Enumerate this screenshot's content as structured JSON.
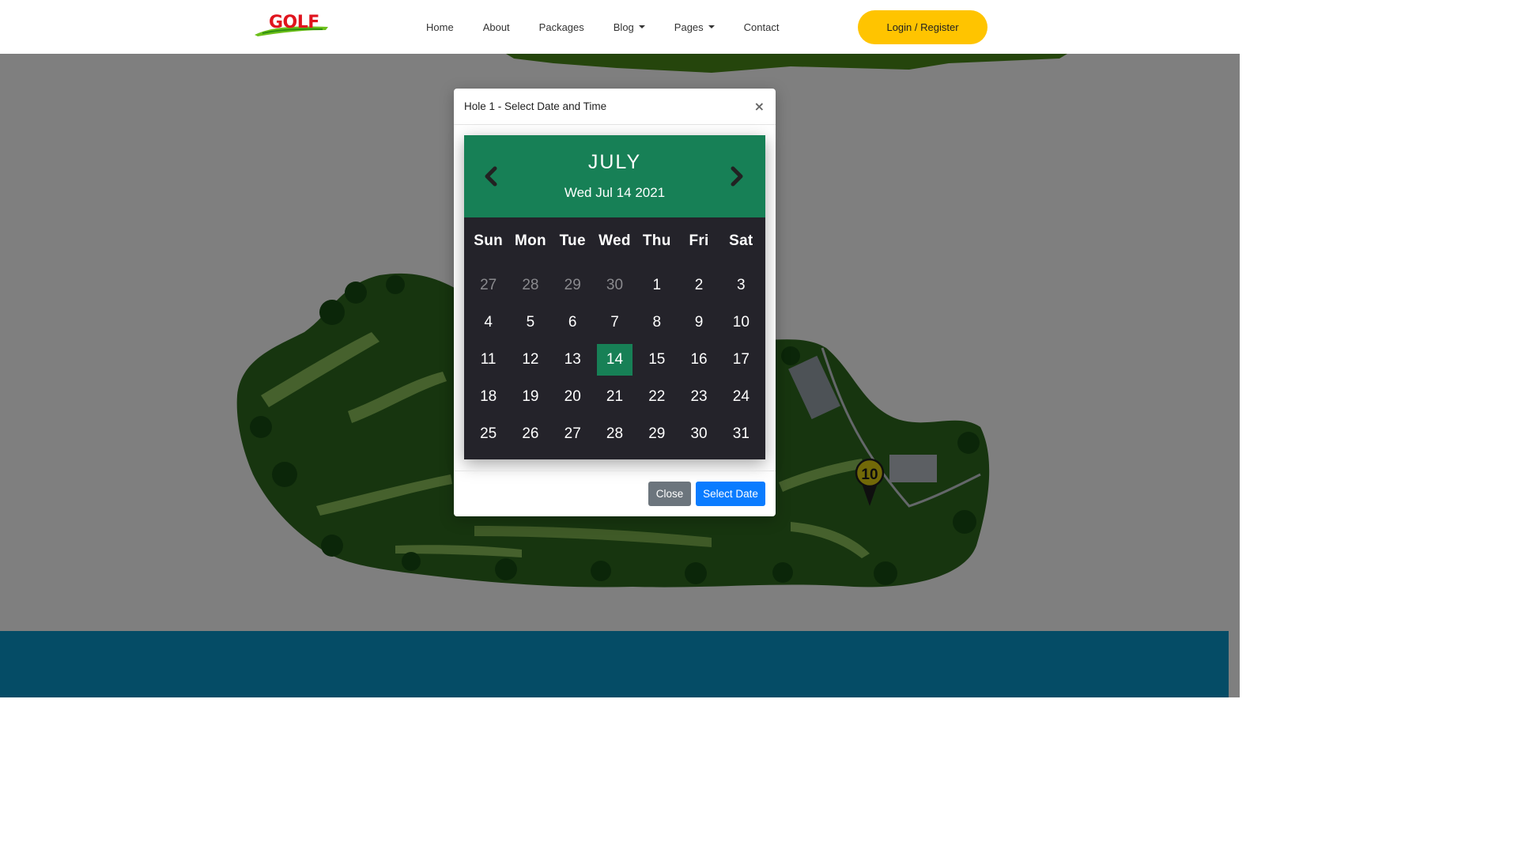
{
  "nav": {
    "logo_text": "GOLF",
    "links": [
      {
        "label": "Home"
      },
      {
        "label": "About"
      },
      {
        "label": "Packages"
      },
      {
        "label": "Blog"
      },
      {
        "label": "Pages"
      },
      {
        "label": "Contact"
      }
    ],
    "login_label": "Login / Register"
  },
  "map": {
    "marker_label": "10"
  },
  "modal": {
    "title": "Hole 1 - Select Date and Time",
    "close_symbol": "×",
    "calendar": {
      "month": "JULY",
      "selected_date_text": "Wed Jul 14 2021",
      "weekdays": [
        "Sun",
        "Mon",
        "Tue",
        "Wed",
        "Thu",
        "Fri",
        "Sat"
      ],
      "days": [
        {
          "label": "27",
          "muted": true
        },
        {
          "label": "28",
          "muted": true
        },
        {
          "label": "29",
          "muted": true
        },
        {
          "label": "30",
          "muted": true
        },
        {
          "label": "1"
        },
        {
          "label": "2"
        },
        {
          "label": "3"
        },
        {
          "label": "4"
        },
        {
          "label": "5"
        },
        {
          "label": "6"
        },
        {
          "label": "7"
        },
        {
          "label": "8"
        },
        {
          "label": "9"
        },
        {
          "label": "10"
        },
        {
          "label": "11"
        },
        {
          "label": "12"
        },
        {
          "label": "13"
        },
        {
          "label": "14",
          "selected": true
        },
        {
          "label": "15"
        },
        {
          "label": "16"
        },
        {
          "label": "17"
        },
        {
          "label": "18"
        },
        {
          "label": "19"
        },
        {
          "label": "20"
        },
        {
          "label": "21"
        },
        {
          "label": "22"
        },
        {
          "label": "23"
        },
        {
          "label": "24"
        },
        {
          "label": "25"
        },
        {
          "label": "26"
        },
        {
          "label": "27"
        },
        {
          "label": "28"
        },
        {
          "label": "29"
        },
        {
          "label": "30"
        },
        {
          "label": "31"
        }
      ]
    },
    "close_button": "Close",
    "select_button": "Select Date"
  },
  "colors": {
    "accent_green": "#178056",
    "calendar_bg": "#24232a",
    "login_yellow": "#ffc400",
    "primary_blue": "#0a7cff",
    "secondary_gray": "#6c757d",
    "footer_blue": "#0a98cc"
  }
}
